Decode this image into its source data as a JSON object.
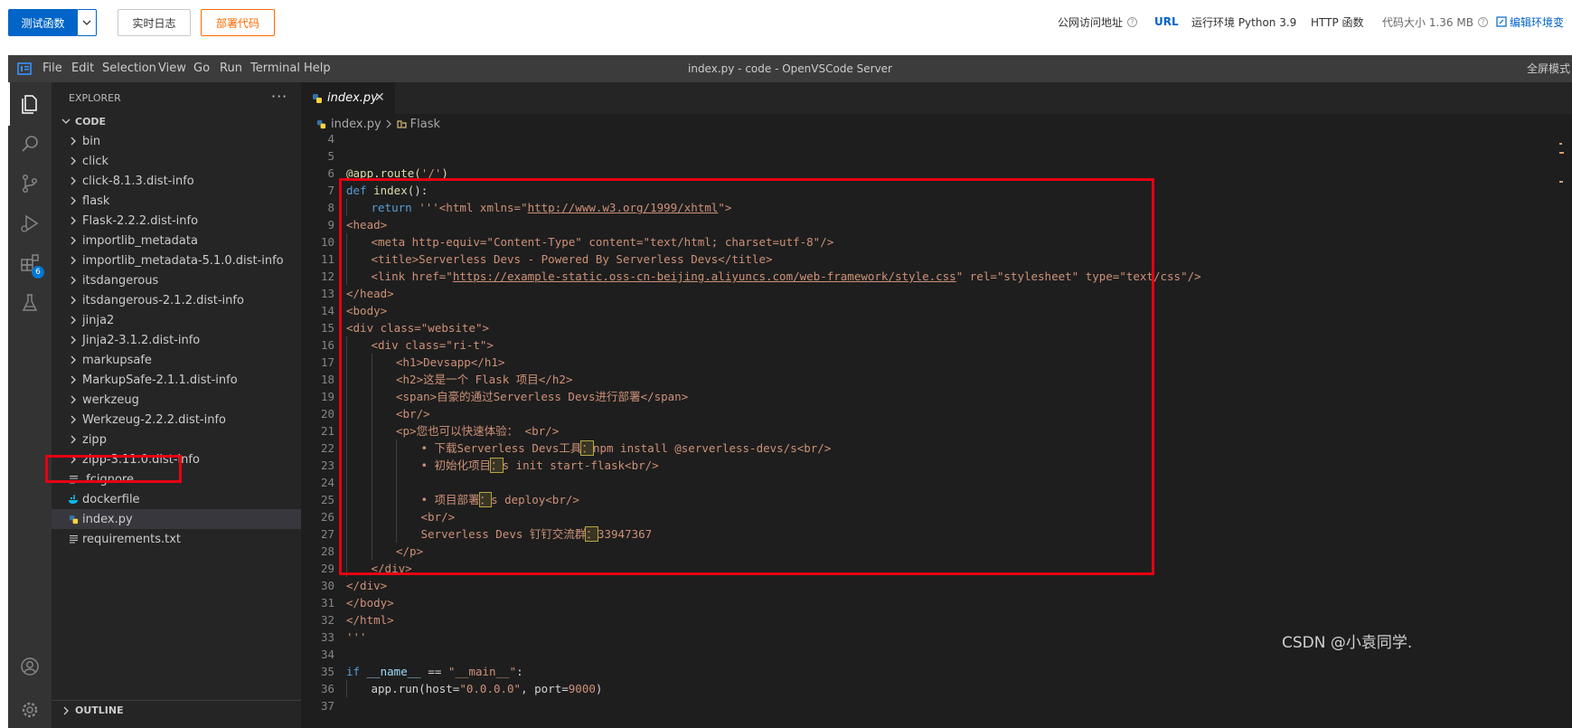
{
  "topbar": {
    "test_fn": "测试函数",
    "realtime_log": "实时日志",
    "deploy_code": "部署代码",
    "public_url_label": "公网访问地址",
    "url_link": "URL",
    "runtime": "运行环境 Python 3.9",
    "http_fn": "HTTP 函数",
    "code_size": "代码大小 1.36 MB",
    "edit_env": "编辑环境变"
  },
  "titlebar": {
    "menu": [
      "File",
      "Edit",
      "Selection",
      "View",
      "Go",
      "Run",
      "Terminal",
      "Help"
    ],
    "window_title": "index.py - code - OpenVSCode Server",
    "fullscreen": "全屏模式"
  },
  "activity": {
    "extensions_badge": "6"
  },
  "sidebar": {
    "title": "EXPLORER",
    "more": "···",
    "root": "CODE",
    "items": [
      {
        "name": "bin",
        "type": "folder"
      },
      {
        "name": "click",
        "type": "folder"
      },
      {
        "name": "click-8.1.3.dist-info",
        "type": "folder"
      },
      {
        "name": "flask",
        "type": "folder"
      },
      {
        "name": "Flask-2.2.2.dist-info",
        "type": "folder"
      },
      {
        "name": "importlib_metadata",
        "type": "folder"
      },
      {
        "name": "importlib_metadata-5.1.0.dist-info",
        "type": "folder"
      },
      {
        "name": "itsdangerous",
        "type": "folder"
      },
      {
        "name": "itsdangerous-2.1.2.dist-info",
        "type": "folder"
      },
      {
        "name": "jinja2",
        "type": "folder"
      },
      {
        "name": "Jinja2-3.1.2.dist-info",
        "type": "folder"
      },
      {
        "name": "markupsafe",
        "type": "folder"
      },
      {
        "name": "MarkupSafe-2.1.1.dist-info",
        "type": "folder"
      },
      {
        "name": "werkzeug",
        "type": "folder"
      },
      {
        "name": "Werkzeug-2.2.2.dist-info",
        "type": "folder"
      },
      {
        "name": "zipp",
        "type": "folder"
      },
      {
        "name": "zipp-3.11.0.dist-info",
        "type": "folder"
      },
      {
        "name": ".fcignore",
        "type": "text"
      },
      {
        "name": "dockerfile",
        "type": "docker"
      },
      {
        "name": "index.py",
        "type": "python",
        "selected": true
      },
      {
        "name": "requirements.txt",
        "type": "text"
      }
    ],
    "outline": "OUTLINE"
  },
  "editor": {
    "tab_label": "index.py",
    "tab_close": "✕",
    "breadcrumb_file": "index.py",
    "breadcrumb_symbol": "Flask"
  },
  "code_lines": [
    {
      "n": "4",
      "indent": 0,
      "tokens": []
    },
    {
      "n": "5",
      "indent": 0,
      "tokens": []
    },
    {
      "n": "6",
      "indent": 0,
      "tokens": [
        {
          "t": "@app.route(",
          "c": "dec"
        },
        {
          "t": "'/'",
          "c": "str"
        },
        {
          "t": ")",
          "c": "dec"
        }
      ]
    },
    {
      "n": "7",
      "indent": 0,
      "tokens": [
        {
          "t": "def ",
          "c": "kw"
        },
        {
          "t": "index",
          "c": "fn"
        },
        {
          "t": "():",
          "c": "pl"
        }
      ]
    },
    {
      "n": "8",
      "indent": 1,
      "tokens": [
        {
          "t": "return ",
          "c": "kw"
        },
        {
          "t": "'''<html xmlns=\"",
          "c": "str"
        },
        {
          "t": "http://www.w3.org/1999/xhtml",
          "c": "link"
        },
        {
          "t": "\">",
          "c": "str"
        }
      ]
    },
    {
      "n": "9",
      "indent": 0,
      "tokens": [
        {
          "t": "<head>",
          "c": "str"
        }
      ]
    },
    {
      "n": "10",
      "indent": 1,
      "tokens": [
        {
          "t": "<meta http-equiv=\"Content-Type\" content=\"text/html; charset=utf-8\"/>",
          "c": "str"
        }
      ]
    },
    {
      "n": "11",
      "indent": 1,
      "tokens": [
        {
          "t": "<title>Serverless Devs - Powered By Serverless Devs</title>",
          "c": "str"
        }
      ]
    },
    {
      "n": "12",
      "indent": 1,
      "tokens": [
        {
          "t": "<link href=\"",
          "c": "str"
        },
        {
          "t": "https://example-static.oss-cn-beijing.aliyuncs.com/web-framework/style.css",
          "c": "link"
        },
        {
          "t": "\" rel=\"stylesheet\" type=\"text/css\"/>",
          "c": "str"
        }
      ]
    },
    {
      "n": "13",
      "indent": 0,
      "tokens": [
        {
          "t": "</head>",
          "c": "str"
        }
      ]
    },
    {
      "n": "14",
      "indent": 0,
      "tokens": [
        {
          "t": "<body>",
          "c": "str"
        }
      ]
    },
    {
      "n": "15",
      "indent": 0,
      "tokens": [
        {
          "t": "<div class=\"website\">",
          "c": "str"
        }
      ]
    },
    {
      "n": "16",
      "indent": 1,
      "tokens": [
        {
          "t": "<div class=\"ri-t\">",
          "c": "str"
        }
      ]
    },
    {
      "n": "17",
      "indent": 2,
      "tokens": [
        {
          "t": "<h1>Devsapp</h1>",
          "c": "str"
        }
      ]
    },
    {
      "n": "18",
      "indent": 2,
      "tokens": [
        {
          "t": "<h2>这是一个 Flask 项目</h2>",
          "c": "str"
        }
      ]
    },
    {
      "n": "19",
      "indent": 2,
      "tokens": [
        {
          "t": "<span>自豪的通过Serverless Devs进行部署</span>",
          "c": "str"
        }
      ]
    },
    {
      "n": "20",
      "indent": 2,
      "tokens": [
        {
          "t": "<br/>",
          "c": "str"
        }
      ]
    },
    {
      "n": "21",
      "indent": 2,
      "tokens": [
        {
          "t": "<p>您也可以快速体验： <br/>",
          "c": "str"
        }
      ]
    },
    {
      "n": "22",
      "indent": 3,
      "tokens": [
        {
          "t": "• 下载Serverless Devs工具",
          "c": "str"
        },
        {
          "t": "：",
          "c": "str",
          "hl": true
        },
        {
          "t": "npm install @serverless-devs/s<br/>",
          "c": "str"
        }
      ]
    },
    {
      "n": "23",
      "indent": 3,
      "tokens": [
        {
          "t": "• 初始化项目",
          "c": "str"
        },
        {
          "t": "：",
          "c": "str",
          "hl": true
        },
        {
          "t": "s init start-flask<br/>",
          "c": "str"
        }
      ]
    },
    {
      "n": "24",
      "indent": 3,
      "tokens": []
    },
    {
      "n": "25",
      "indent": 3,
      "tokens": [
        {
          "t": "• 项目部署",
          "c": "str"
        },
        {
          "t": "：",
          "c": "str",
          "hl": true
        },
        {
          "t": "s deploy<br/>",
          "c": "str"
        }
      ]
    },
    {
      "n": "26",
      "indent": 3,
      "tokens": [
        {
          "t": "<br/>",
          "c": "str"
        }
      ]
    },
    {
      "n": "27",
      "indent": 3,
      "tokens": [
        {
          "t": "Serverless Devs 钉钉交流群",
          "c": "str"
        },
        {
          "t": "：",
          "c": "str",
          "hl": true
        },
        {
          "t": "33947367",
          "c": "str"
        }
      ]
    },
    {
      "n": "28",
      "indent": 2,
      "tokens": [
        {
          "t": "</p>",
          "c": "str"
        }
      ]
    },
    {
      "n": "29",
      "indent": 1,
      "tokens": [
        {
          "t": "</div>",
          "c": "str"
        }
      ]
    },
    {
      "n": "30",
      "indent": 0,
      "tokens": [
        {
          "t": "</div>",
          "c": "str"
        }
      ]
    },
    {
      "n": "31",
      "indent": 0,
      "tokens": [
        {
          "t": "</body>",
          "c": "str"
        }
      ]
    },
    {
      "n": "32",
      "indent": 0,
      "tokens": [
        {
          "t": "</html>",
          "c": "str"
        }
      ]
    },
    {
      "n": "33",
      "indent": 0,
      "tokens": [
        {
          "t": "'''",
          "c": "str"
        }
      ]
    },
    {
      "n": "34",
      "indent": 0,
      "tokens": []
    },
    {
      "n": "35",
      "indent": 0,
      "tokens": [
        {
          "t": "if ",
          "c": "kw"
        },
        {
          "t": "__name__",
          "c": "vr"
        },
        {
          "t": " == ",
          "c": "pl"
        },
        {
          "t": "\"__main__\"",
          "c": "str"
        },
        {
          "t": ":",
          "c": "pl"
        }
      ]
    },
    {
      "n": "36",
      "indent": 1,
      "tokens": [
        {
          "t": "app.run(host=",
          "c": "pl"
        },
        {
          "t": "\"0.0.0.0\"",
          "c": "str"
        },
        {
          "t": ", port=",
          "c": "pl"
        },
        {
          "t": "9000",
          "c": "str"
        },
        {
          "t": ")",
          "c": "pl"
        }
      ]
    },
    {
      "n": "37",
      "indent": 0,
      "tokens": []
    }
  ],
  "watermark": "CSDN @小袁同学.",
  "colors": {
    "highlight_box": "#e60012",
    "accent": "#0064c8",
    "deploy": "#ff6a00"
  }
}
